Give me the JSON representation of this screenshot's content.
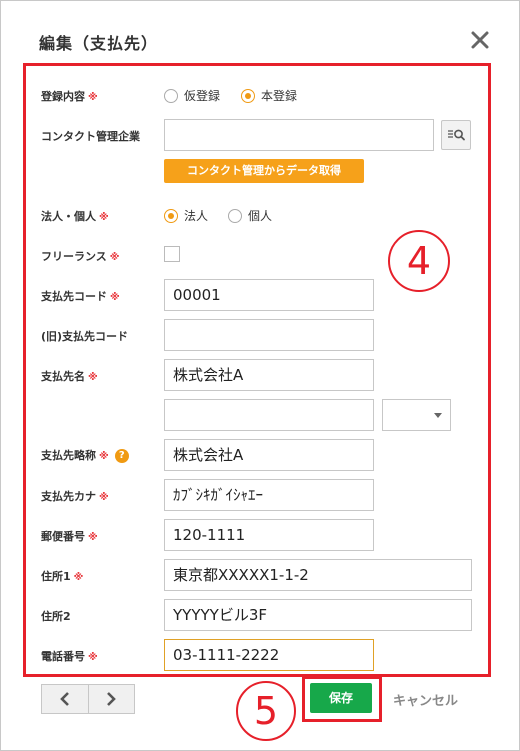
{
  "dialog": {
    "title": "編集（支払先）"
  },
  "required_mark": "※",
  "fields": {
    "registration": {
      "label": "登録内容",
      "options": [
        "仮登録",
        "本登録"
      ],
      "selected": "本登録"
    },
    "contact_company": {
      "label": "コンタクト管理企業",
      "value": "",
      "fetch_button": "コンタクト管理からデータ取得"
    },
    "entity_type": {
      "label": "法人・個人",
      "options": [
        "法人",
        "個人"
      ],
      "selected": "法人"
    },
    "freelance": {
      "label": "フリーランス",
      "checked": false
    },
    "payee_code": {
      "label": "支払先コード",
      "value": "00001"
    },
    "old_payee_code": {
      "label": "(旧)支払先コード",
      "value": ""
    },
    "payee_name": {
      "label": "支払先名",
      "value": "株式会社A",
      "value2": "",
      "select_value": ""
    },
    "payee_short_name": {
      "label": "支払先略称",
      "value": "株式会社A",
      "help": "?"
    },
    "payee_kana": {
      "label": "支払先カナ",
      "value": "ｶﾌﾞｼｷｶﾞｲｼｬｴｰ"
    },
    "postal_code": {
      "label": "郵便番号",
      "value": "120-1111"
    },
    "address1": {
      "label": "住所1",
      "value": "東京都XXXXX1-1-2"
    },
    "address2": {
      "label": "住所2",
      "value": "YYYYYビル3F"
    },
    "phone": {
      "label": "電話番号",
      "value": "03-1111-2222"
    }
  },
  "footer": {
    "save_label": "保存",
    "cancel_label": "キャンセル"
  },
  "annotations": {
    "step4": "4",
    "step5": "5"
  },
  "colors": {
    "accent_orange": "#f6a11a",
    "save_green": "#17a84a",
    "annotation_red": "#e6202a",
    "required_red": "#e8383d"
  }
}
